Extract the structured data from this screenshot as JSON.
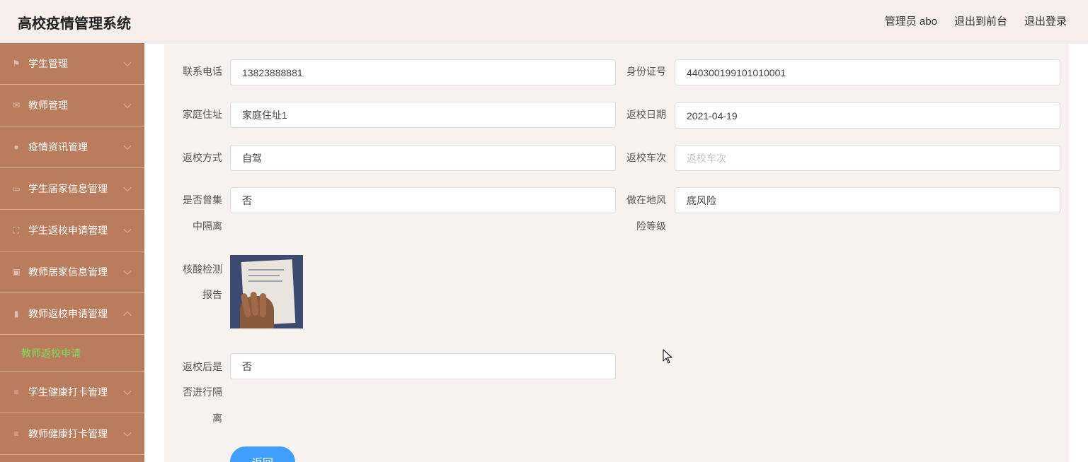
{
  "header": {
    "title": "高校疫情管理系统",
    "admin": "管理员 abo",
    "to_front": "退出到前台",
    "logout": "退出登录"
  },
  "sidebar": {
    "items": [
      {
        "label": "学生管理",
        "icon": "flag-icon"
      },
      {
        "label": "教师管理",
        "icon": "mail-icon"
      },
      {
        "label": "疫情资讯管理",
        "icon": "location-icon"
      },
      {
        "label": "学生居家信息管理",
        "icon": "chat-icon"
      },
      {
        "label": "学生返校申请管理",
        "icon": "fullscreen-icon"
      },
      {
        "label": "教师居家信息管理",
        "icon": "picture-icon"
      },
      {
        "label": "教师返校申请管理",
        "icon": "bar-chart-icon"
      },
      {
        "label": "学生健康打卡管理",
        "icon": "menu-icon"
      },
      {
        "label": "教师健康打卡管理",
        "icon": "menu-icon"
      }
    ],
    "active_sub": "教师返校申请"
  },
  "form": {
    "phone_label": "联系电话",
    "phone_value": "13823888881",
    "id_label": "身份证号",
    "id_value": "440300199101010001",
    "address_label": "家庭住址",
    "address_value": "家庭住址1",
    "return_date_label": "返校日期",
    "return_date_value": "2021-04-19",
    "method_label": "返校方式",
    "method_value": "自驾",
    "train_label": "返校车次",
    "train_placeholder": "返校车次",
    "quarantined_label_1": "是否曾集",
    "quarantined_label_2": "中隔离",
    "quarantined_value": "否",
    "risk_label_1": "做在地风",
    "risk_label_2": "险等级",
    "risk_value": "底风险",
    "report_label_1": "核酸检测",
    "report_label_2": "报告",
    "after_label_1": "返校后是",
    "after_label_2": "否进行隔",
    "after_label_3": "离",
    "after_value": "否",
    "back_button": "返回"
  }
}
